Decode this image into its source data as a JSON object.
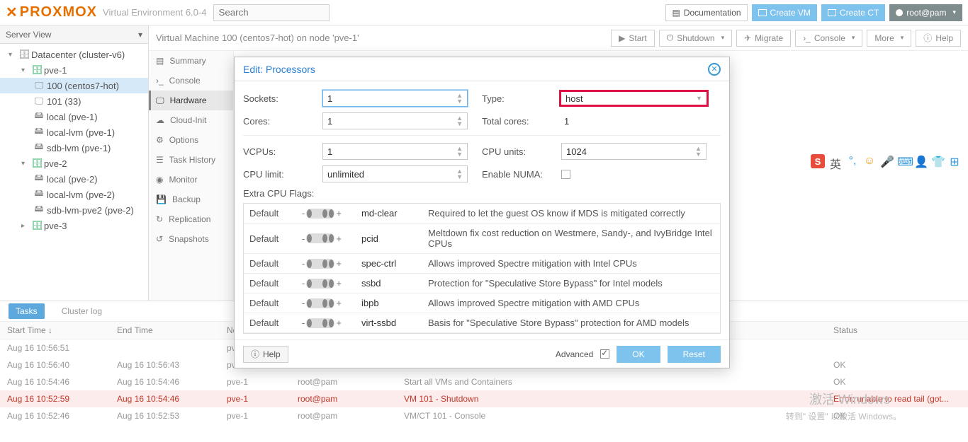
{
  "app": {
    "product": "PROXMOX",
    "subtitle": "Virtual Environment 6.0-4",
    "search_placeholder": "Search"
  },
  "topbar": {
    "documentation": "Documentation",
    "create_vm": "Create VM",
    "create_ct": "Create CT",
    "user": "root@pam"
  },
  "serverview": {
    "title": "Server View"
  },
  "tree": {
    "datacenter": "Datacenter (cluster-v6)",
    "pve1": "pve-1",
    "vm100": "100 (centos7-hot)",
    "vm101": "101 (33)",
    "local1": "local (pve-1)",
    "locallvm1": "local-lvm (pve-1)",
    "sdblvm1": "sdb-lvm (pve-1)",
    "pve2": "pve-2",
    "local2": "local (pve-2)",
    "locallvm2": "local-lvm (pve-2)",
    "sdblvm2": "sdb-lvm-pve2 (pve-2)",
    "pve3": "pve-3"
  },
  "vm": {
    "title": "Virtual Machine 100 (centos7-hot) on node 'pve-1'",
    "actions": {
      "start": "Start",
      "shutdown": "Shutdown",
      "migrate": "Migrate",
      "console": "Console",
      "more": "More",
      "help": "Help"
    }
  },
  "sidemenu": {
    "summary": "Summary",
    "console": "Console",
    "hardware": "Hardware",
    "cloudinit": "Cloud-Init",
    "options": "Options",
    "taskhistory": "Task History",
    "monitor": "Monitor",
    "backup": "Backup",
    "replication": "Replication",
    "snapshots": "Snapshots"
  },
  "modal": {
    "title": "Edit: Processors",
    "labels": {
      "sockets": "Sockets:",
      "type": "Type:",
      "cores": "Cores:",
      "totalcores": "Total cores:",
      "vcpus": "VCPUs:",
      "cpuunits": "CPU units:",
      "cpulimit": "CPU limit:",
      "numa": "Enable NUMA:",
      "extraflags": "Extra CPU Flags:"
    },
    "values": {
      "sockets": "1",
      "type": "host",
      "cores": "1",
      "totalcores": "1",
      "vcpus": "1",
      "cpuunits": "1024",
      "cpulimit": "unlimited"
    },
    "flags": [
      {
        "def": "Default",
        "name": "md-clear",
        "desc": "Required to let the guest OS know if MDS is mitigated correctly"
      },
      {
        "def": "Default",
        "name": "pcid",
        "desc": "Meltdown fix cost reduction on Westmere, Sandy-, and IvyBridge Intel CPUs"
      },
      {
        "def": "Default",
        "name": "spec-ctrl",
        "desc": "Allows improved Spectre mitigation with Intel CPUs"
      },
      {
        "def": "Default",
        "name": "ssbd",
        "desc": "Protection for \"Speculative Store Bypass\" for Intel models"
      },
      {
        "def": "Default",
        "name": "ibpb",
        "desc": "Allows improved Spectre mitigation with AMD CPUs"
      },
      {
        "def": "Default",
        "name": "virt-ssbd",
        "desc": "Basis for \"Speculative Store Bypass\" protection for AMD models"
      }
    ],
    "footer": {
      "help": "Help",
      "advanced": "Advanced",
      "ok": "OK",
      "reset": "Reset"
    }
  },
  "tasks": {
    "tabs": {
      "tasks": "Tasks",
      "clusterlog": "Cluster log"
    },
    "cols": {
      "start": "Start Time ↓",
      "end": "End Time",
      "node": "No",
      "user": "",
      "desc": "",
      "status": "Status"
    },
    "rows": [
      {
        "start": "Aug 16 10:56:51",
        "end": "",
        "node": "pv",
        "user": "",
        "desc": "",
        "status": ""
      },
      {
        "start": "Aug 16 10:56:40",
        "end": "Aug 16 10:56:43",
        "node": "pv",
        "user": "",
        "desc": "",
        "status": "OK"
      },
      {
        "start": "Aug 16 10:54:46",
        "end": "Aug 16 10:54:46",
        "node": "pve-1",
        "user": "root@pam",
        "desc": "Start all VMs and Containers",
        "status": "OK"
      },
      {
        "start": "Aug 16 10:52:59",
        "end": "Aug 16 10:54:46",
        "node": "pve-1",
        "user": "root@pam",
        "desc": "VM 101 - Shutdown",
        "status": "Error: unable to read tail (got..."
      },
      {
        "start": "Aug 16 10:52:46",
        "end": "Aug 16 10:52:53",
        "node": "pve-1",
        "user": "root@pam",
        "desc": "VM/CT 101 - Console",
        "status": "OK"
      }
    ]
  },
  "watermark": {
    "l1": "激活 Windows",
    "l2": "转到\" 设置\" 以激活 Windows。"
  },
  "ime": {
    "lang": "英"
  }
}
